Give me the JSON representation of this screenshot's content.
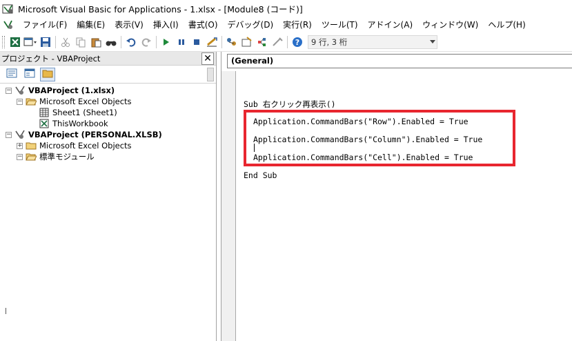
{
  "window": {
    "title": "Microsoft Visual Basic for Applications - 1.xlsx - [Module8 (コード)]"
  },
  "menu": {
    "items": [
      {
        "label": "ファイル(F)"
      },
      {
        "label": "編集(E)"
      },
      {
        "label": "表示(V)"
      },
      {
        "label": "挿入(I)"
      },
      {
        "label": "書式(O)"
      },
      {
        "label": "デバッグ(D)"
      },
      {
        "label": "実行(R)"
      },
      {
        "label": "ツール(T)"
      },
      {
        "label": "アドイン(A)"
      },
      {
        "label": "ウィンドウ(W)"
      },
      {
        "label": "ヘルプ(H)"
      }
    ]
  },
  "toolbar": {
    "position_status": "9 行, 3 桁",
    "icons": [
      "excel-icon",
      "insert-userform-icon",
      "save-icon",
      "cut-icon",
      "copy-icon",
      "paste-icon",
      "find-icon",
      "undo-icon",
      "redo-icon",
      "run-icon",
      "break-icon",
      "reset-icon",
      "design-mode-icon",
      "project-explorer-icon",
      "properties-icon",
      "object-browser-icon",
      "toolbox-icon",
      "help-icon"
    ]
  },
  "project": {
    "header": "プロジェクト - VBAProject",
    "close_label": "✕",
    "tree": [
      {
        "label": "VBAProject (1.xlsx)",
        "bold": true
      },
      {
        "label": "Microsoft Excel Objects",
        "bold": false
      },
      {
        "label": "Sheet1 (Sheet1)",
        "bold": false
      },
      {
        "label": "ThisWorkbook",
        "bold": false
      },
      {
        "label": "VBAProject (PERSONAL.XLSB)",
        "bold": true
      },
      {
        "label": "Microsoft Excel Objects",
        "bold": false
      },
      {
        "label": "標準モジュール",
        "bold": false
      }
    ]
  },
  "code": {
    "object_combo": "(General)",
    "lines": [
      "Sub 右クリック再表示()",
      "Application.CommandBars(\"Row\").Enabled = True",
      "Application.CommandBars(\"Column\").Enabled = True",
      "Application.CommandBars(\"Cell\").Enabled = True",
      "End Sub"
    ],
    "highlight_color": "#e8262f"
  }
}
